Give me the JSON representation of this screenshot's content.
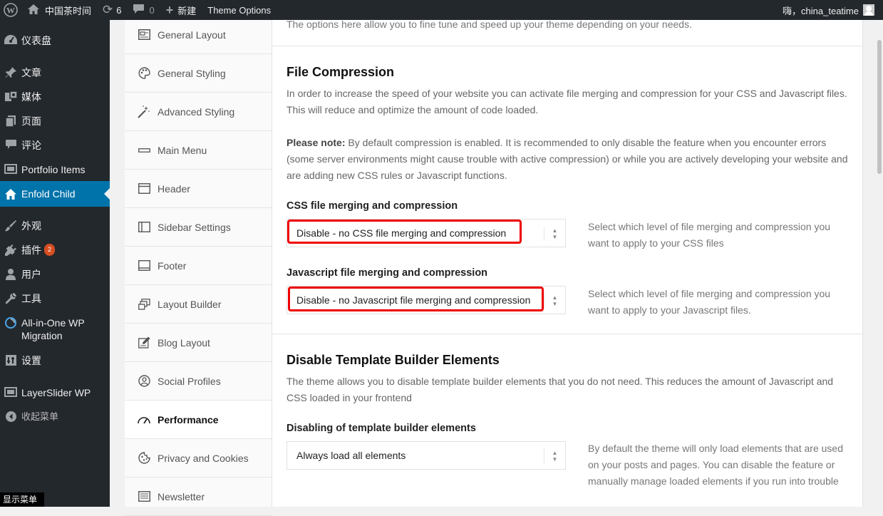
{
  "admin_bar": {
    "site_name": "中国茶时间",
    "updates_count": "6",
    "comments_count": "0",
    "new_label": "新建",
    "theme_options_label": "Theme Options",
    "greeting": "嗨，china_teatime"
  },
  "admin_menu": {
    "items": [
      {
        "label": "仪表盘",
        "icon": "dashboard-icon"
      },
      {
        "label": "文章",
        "icon": "pin-icon"
      },
      {
        "label": "媒体",
        "icon": "media-icon"
      },
      {
        "label": "页面",
        "icon": "page-icon"
      },
      {
        "label": "评论",
        "icon": "comment-icon"
      },
      {
        "label": "Portfolio Items",
        "icon": "portfolio-icon"
      },
      {
        "label": "Enfold Child",
        "icon": "home-icon"
      },
      {
        "label": "外观",
        "icon": "brush-icon"
      },
      {
        "label": "插件",
        "icon": "plugin-icon",
        "badge": "2"
      },
      {
        "label": "用户",
        "icon": "user-icon"
      },
      {
        "label": "工具",
        "icon": "wrench-icon"
      },
      {
        "label": "All-in-One WP Migration",
        "icon": "migration-icon"
      },
      {
        "label": "设置",
        "icon": "settings-icon"
      },
      {
        "label": "LayerSlider WP",
        "icon": "layers-icon"
      },
      {
        "label": "收起菜单",
        "icon": "collapse-icon"
      }
    ],
    "show_menu": "显示菜单"
  },
  "option_tabs": [
    "General Layout",
    "General Styling",
    "Advanced Styling",
    "Main Menu",
    "Header",
    "Sidebar Settings",
    "Footer",
    "Layout Builder",
    "Blog Layout",
    "Social Profiles",
    "Performance",
    "Privacy and Cookies",
    "Newsletter"
  ],
  "content": {
    "intro": "The options here allow you to fine tune and speed up your theme depending on your needs.",
    "file_compression": {
      "title": "File Compression",
      "description": "In order to increase the speed of your website you can activate file merging and compression for your CSS and Javascript files. This will reduce and optimize the amount of code loaded.",
      "note_strong": "Please note:",
      "note_text": " By default compression is enabled. It is recommended to only disable the feature when you encounter errors (some server environments might cause trouble with active compression) or while you are actively developing your website and are adding new CSS rules or Javascript functions.",
      "css_label": "CSS file merging and compression",
      "css_value": "Disable - no CSS file merging and compression",
      "css_desc": "Select which level of file merging and compression you want to apply to your CSS files",
      "js_label": "Javascript file merging and compression",
      "js_value": "Disable - no Javascript file merging and compression",
      "js_desc": "Select which level of file merging and compression you want to apply to your Javascript files."
    },
    "template_builder": {
      "title": "Disable Template Builder Elements",
      "description": "The theme allows you to disable template builder elements that you do not need. This reduces the amount of Javascript and CSS loaded in your frontend",
      "label": "Disabling of template builder elements",
      "value": "Always load all elements",
      "desc": "By default the theme will only load elements that are used on your posts and pages. You can disable the feature or manually manage loaded elements if you run into trouble"
    }
  },
  "colors": {
    "admin_dark": "#23282d",
    "accent_blue": "#0073aa",
    "highlight_red": "#e00000",
    "badge_orange": "#d54e21"
  }
}
